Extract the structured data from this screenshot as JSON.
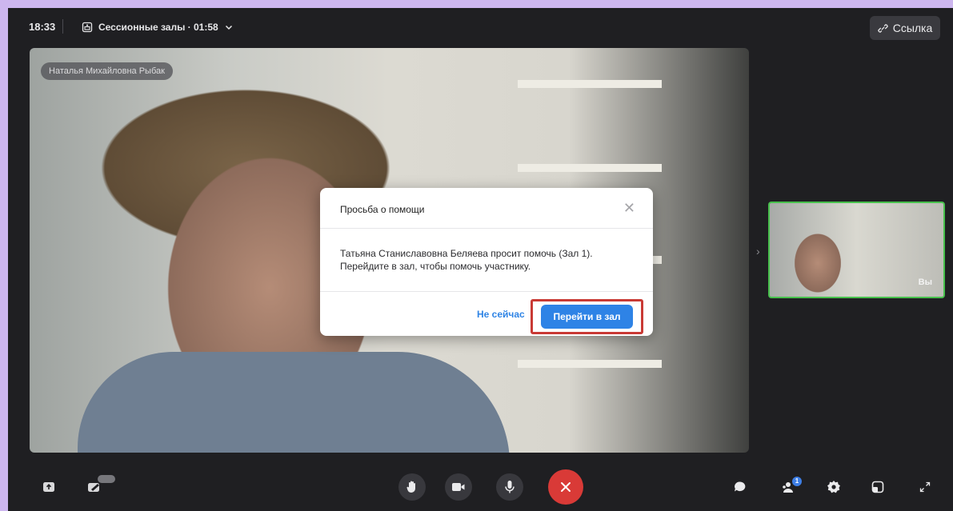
{
  "topbar": {
    "time": "18:33",
    "rooms_label": "Сессионные залы · 01:58",
    "link_label": "Ссылка"
  },
  "main_video": {
    "participant_name": "Наталья Михайловна Рыбак"
  },
  "self_view": {
    "label": "Вы"
  },
  "modal": {
    "title": "Просьба о помощи",
    "message_line1": "Татьяна Станиславовна Беляева просит помочь (Зал 1).",
    "message_line2": "Перейдите в зал, чтобы помочь участнику.",
    "secondary_button": "Не сейчас",
    "primary_button": "Перейти в зал"
  },
  "controls": {
    "participants_count": "1"
  },
  "colors": {
    "accent": "#2e83e6",
    "end_call": "#d93a37",
    "self_border": "#47c04c",
    "highlight": "#c93a35"
  }
}
